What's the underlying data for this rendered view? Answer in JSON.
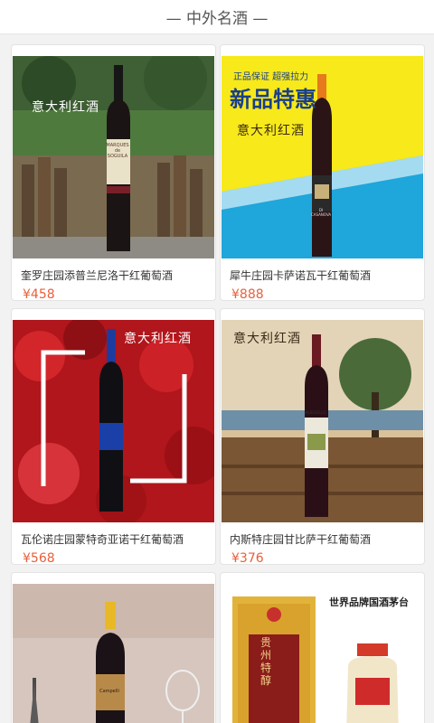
{
  "header": {
    "title": "— 中外名酒 —"
  },
  "products": [
    {
      "name": "奎罗庄园添普兰尼洛干红葡萄酒",
      "price": "¥458",
      "badge": "意大利红酒",
      "label_text": "MARQUES de SOGUILA"
    },
    {
      "name": "犀牛庄园卡萨诺瓦干红葡萄酒",
      "price": "¥888",
      "badge": "意大利红酒",
      "promo_small": "正品保证 超强拉力",
      "promo_big": "新品特惠",
      "label_text": "DI CASANOVA"
    },
    {
      "name": "瓦伦诺庄园蒙特奇亚诺干红葡萄酒",
      "price": "¥568",
      "badge": "意大利红酒"
    },
    {
      "name": "内斯特庄园甘比萨干红葡萄酒",
      "price": "¥376",
      "badge": "意大利红酒",
      "label_text": "ALBERELLO"
    },
    {
      "name": "",
      "price": "",
      "badge": "",
      "label_text": "Campelli"
    },
    {
      "name": "",
      "price": "",
      "badge": "世界品牌国酒茅台",
      "label_text": "贵州特醇"
    }
  ]
}
